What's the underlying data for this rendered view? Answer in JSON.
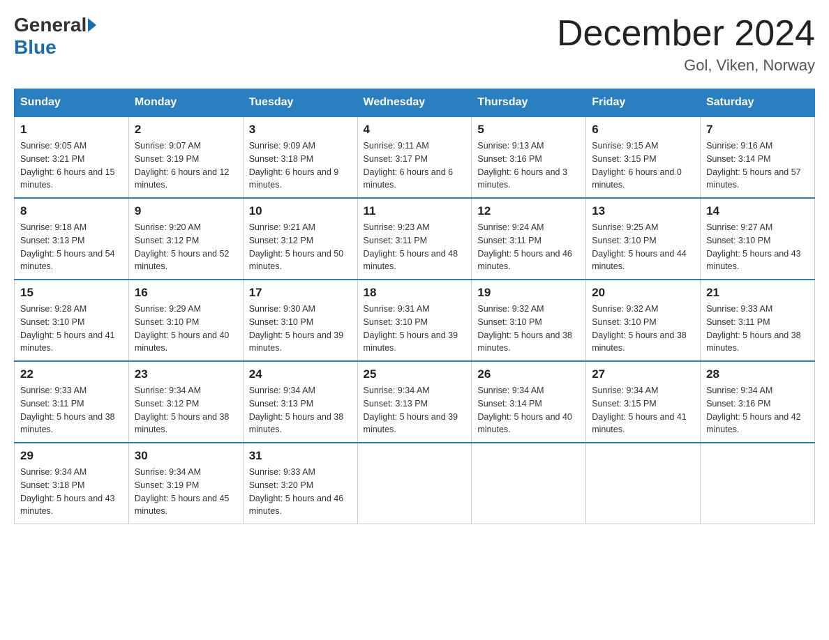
{
  "header": {
    "logo_general": "General",
    "logo_blue": "Blue",
    "title": "December 2024",
    "location": "Gol, Viken, Norway"
  },
  "days_of_week": [
    "Sunday",
    "Monday",
    "Tuesday",
    "Wednesday",
    "Thursday",
    "Friday",
    "Saturday"
  ],
  "weeks": [
    [
      {
        "day": "1",
        "sunrise": "9:05 AM",
        "sunset": "3:21 PM",
        "daylight": "6 hours and 15 minutes."
      },
      {
        "day": "2",
        "sunrise": "9:07 AM",
        "sunset": "3:19 PM",
        "daylight": "6 hours and 12 minutes."
      },
      {
        "day": "3",
        "sunrise": "9:09 AM",
        "sunset": "3:18 PM",
        "daylight": "6 hours and 9 minutes."
      },
      {
        "day": "4",
        "sunrise": "9:11 AM",
        "sunset": "3:17 PM",
        "daylight": "6 hours and 6 minutes."
      },
      {
        "day": "5",
        "sunrise": "9:13 AM",
        "sunset": "3:16 PM",
        "daylight": "6 hours and 3 minutes."
      },
      {
        "day": "6",
        "sunrise": "9:15 AM",
        "sunset": "3:15 PM",
        "daylight": "6 hours and 0 minutes."
      },
      {
        "day": "7",
        "sunrise": "9:16 AM",
        "sunset": "3:14 PM",
        "daylight": "5 hours and 57 minutes."
      }
    ],
    [
      {
        "day": "8",
        "sunrise": "9:18 AM",
        "sunset": "3:13 PM",
        "daylight": "5 hours and 54 minutes."
      },
      {
        "day": "9",
        "sunrise": "9:20 AM",
        "sunset": "3:12 PM",
        "daylight": "5 hours and 52 minutes."
      },
      {
        "day": "10",
        "sunrise": "9:21 AM",
        "sunset": "3:12 PM",
        "daylight": "5 hours and 50 minutes."
      },
      {
        "day": "11",
        "sunrise": "9:23 AM",
        "sunset": "3:11 PM",
        "daylight": "5 hours and 48 minutes."
      },
      {
        "day": "12",
        "sunrise": "9:24 AM",
        "sunset": "3:11 PM",
        "daylight": "5 hours and 46 minutes."
      },
      {
        "day": "13",
        "sunrise": "9:25 AM",
        "sunset": "3:10 PM",
        "daylight": "5 hours and 44 minutes."
      },
      {
        "day": "14",
        "sunrise": "9:27 AM",
        "sunset": "3:10 PM",
        "daylight": "5 hours and 43 minutes."
      }
    ],
    [
      {
        "day": "15",
        "sunrise": "9:28 AM",
        "sunset": "3:10 PM",
        "daylight": "5 hours and 41 minutes."
      },
      {
        "day": "16",
        "sunrise": "9:29 AM",
        "sunset": "3:10 PM",
        "daylight": "5 hours and 40 minutes."
      },
      {
        "day": "17",
        "sunrise": "9:30 AM",
        "sunset": "3:10 PM",
        "daylight": "5 hours and 39 minutes."
      },
      {
        "day": "18",
        "sunrise": "9:31 AM",
        "sunset": "3:10 PM",
        "daylight": "5 hours and 39 minutes."
      },
      {
        "day": "19",
        "sunrise": "9:32 AM",
        "sunset": "3:10 PM",
        "daylight": "5 hours and 38 minutes."
      },
      {
        "day": "20",
        "sunrise": "9:32 AM",
        "sunset": "3:10 PM",
        "daylight": "5 hours and 38 minutes."
      },
      {
        "day": "21",
        "sunrise": "9:33 AM",
        "sunset": "3:11 PM",
        "daylight": "5 hours and 38 minutes."
      }
    ],
    [
      {
        "day": "22",
        "sunrise": "9:33 AM",
        "sunset": "3:11 PM",
        "daylight": "5 hours and 38 minutes."
      },
      {
        "day": "23",
        "sunrise": "9:34 AM",
        "sunset": "3:12 PM",
        "daylight": "5 hours and 38 minutes."
      },
      {
        "day": "24",
        "sunrise": "9:34 AM",
        "sunset": "3:13 PM",
        "daylight": "5 hours and 38 minutes."
      },
      {
        "day": "25",
        "sunrise": "9:34 AM",
        "sunset": "3:13 PM",
        "daylight": "5 hours and 39 minutes."
      },
      {
        "day": "26",
        "sunrise": "9:34 AM",
        "sunset": "3:14 PM",
        "daylight": "5 hours and 40 minutes."
      },
      {
        "day": "27",
        "sunrise": "9:34 AM",
        "sunset": "3:15 PM",
        "daylight": "5 hours and 41 minutes."
      },
      {
        "day": "28",
        "sunrise": "9:34 AM",
        "sunset": "3:16 PM",
        "daylight": "5 hours and 42 minutes."
      }
    ],
    [
      {
        "day": "29",
        "sunrise": "9:34 AM",
        "sunset": "3:18 PM",
        "daylight": "5 hours and 43 minutes."
      },
      {
        "day": "30",
        "sunrise": "9:34 AM",
        "sunset": "3:19 PM",
        "daylight": "5 hours and 45 minutes."
      },
      {
        "day": "31",
        "sunrise": "9:33 AM",
        "sunset": "3:20 PM",
        "daylight": "5 hours and 46 minutes."
      },
      null,
      null,
      null,
      null
    ]
  ]
}
